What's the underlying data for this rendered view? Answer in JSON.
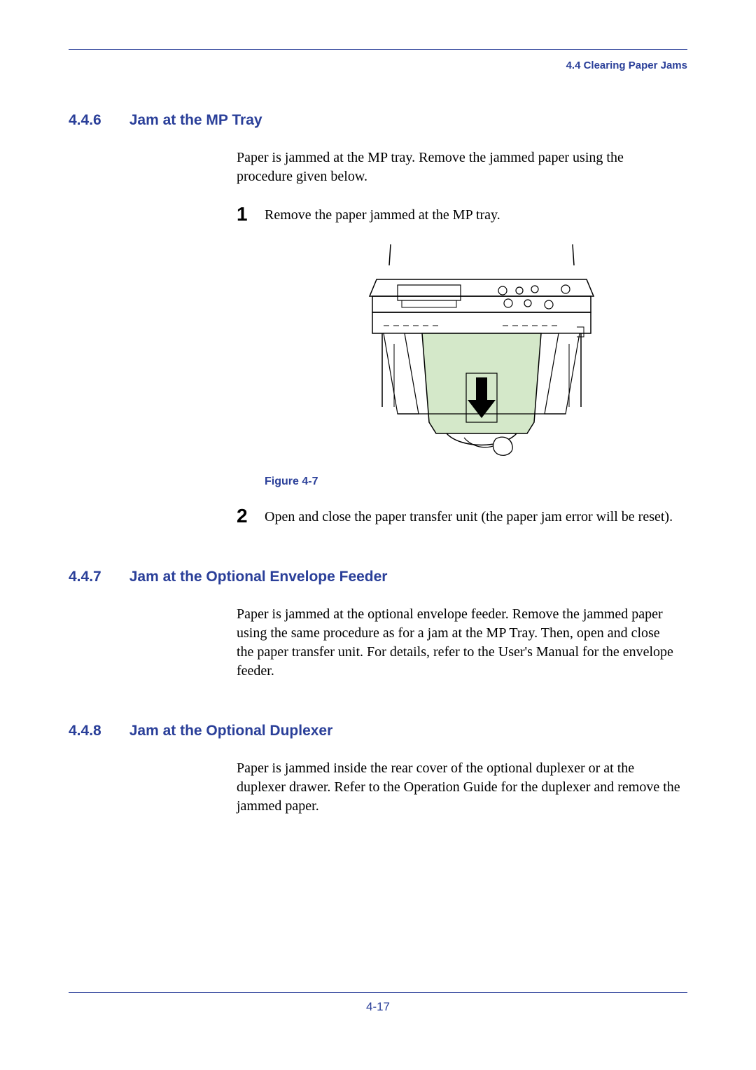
{
  "header": {
    "breadcrumb": "4.4 Clearing Paper Jams"
  },
  "sections": {
    "s446": {
      "number": "4.4.6",
      "title": "Jam at the MP Tray",
      "intro": "Paper is jammed at the MP tray. Remove the jammed paper using the procedure given below.",
      "step1": "Remove the paper jammed at the MP tray.",
      "figure_caption": "Figure 4-7",
      "step2": "Open and close the paper transfer unit (the paper jam error will be reset)."
    },
    "s447": {
      "number": "4.4.7",
      "title": "Jam at the Optional Envelope Feeder",
      "body": "Paper is jammed at the optional envelope feeder. Remove the jammed paper using the same procedure as for a jam at the MP Tray. Then, open and close the paper transfer unit. For details, refer to the User's Manual for the envelope feeder."
    },
    "s448": {
      "number": "4.4.8",
      "title": "Jam at the Optional Duplexer",
      "body": "Paper is jammed inside the rear cover of the optional duplexer or at the duplexer drawer. Refer to the Operation Guide for the duplexer and remove the jammed paper."
    }
  },
  "step_numbers": {
    "one": "1",
    "two": "2"
  },
  "page_number": "4-17"
}
